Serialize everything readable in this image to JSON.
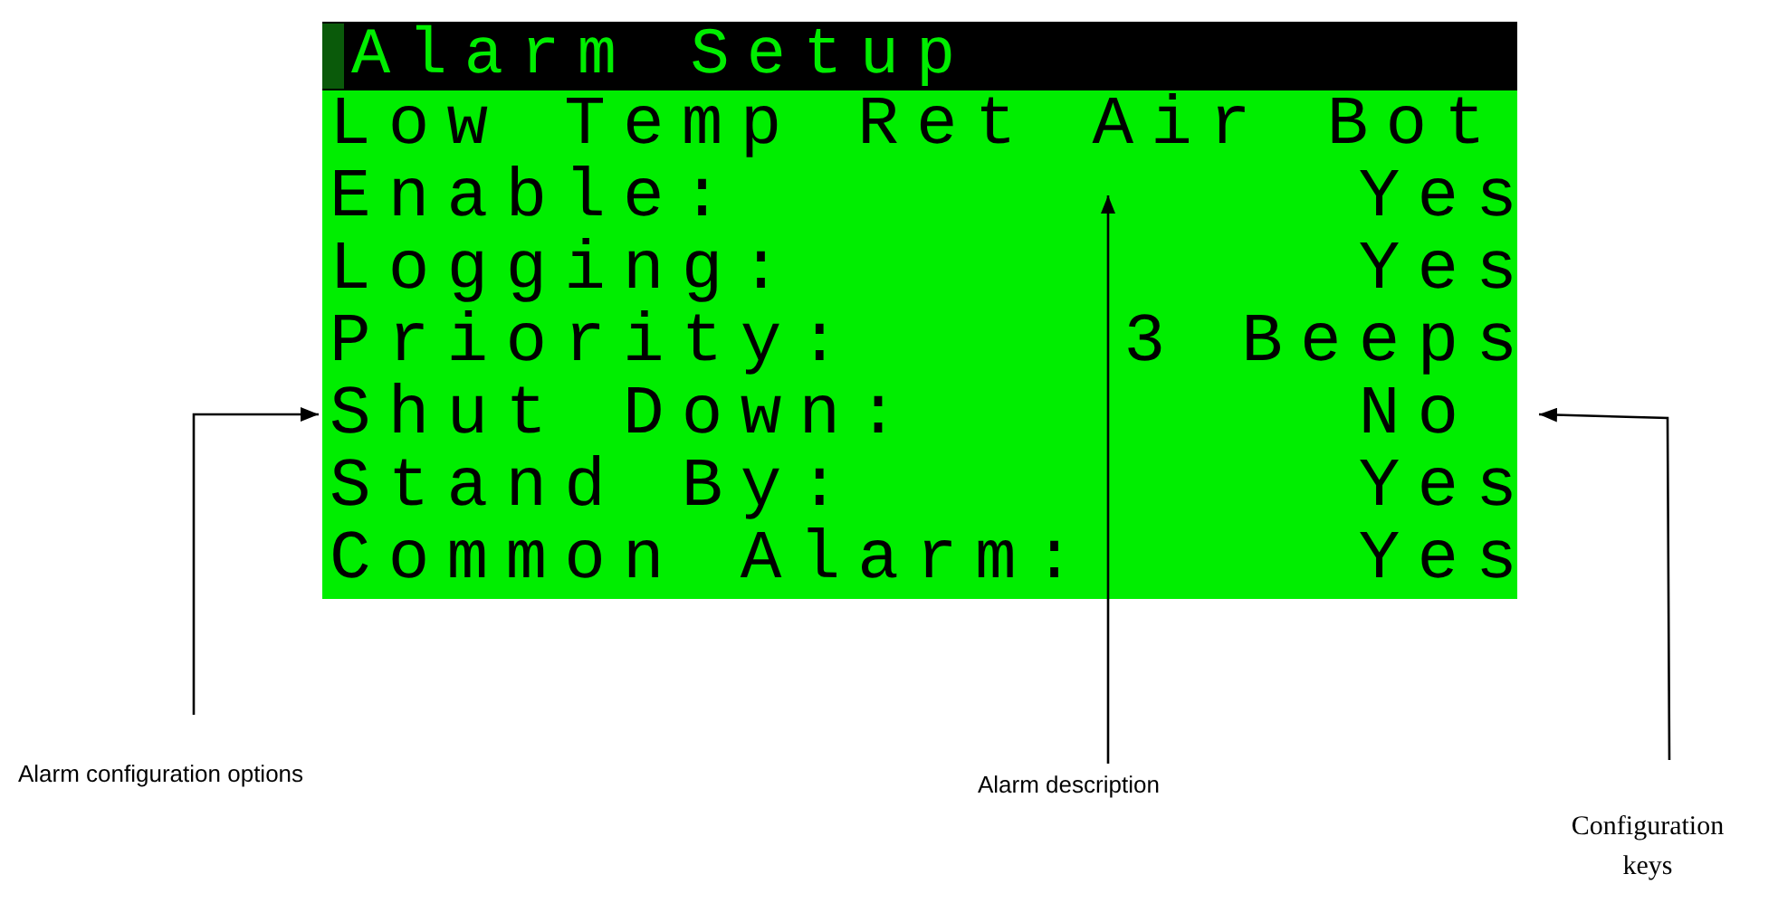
{
  "display": {
    "title": "Alarm Setup",
    "description": "Low Temp Ret Air Bot",
    "rows": [
      {
        "label": "Enable:",
        "value": "Yes"
      },
      {
        "label": "Logging:",
        "value": "Yes"
      },
      {
        "label": "Priority:",
        "value": "3 Beeps"
      },
      {
        "label": "Shut Down:",
        "value": "No "
      },
      {
        "label": "Stand By:",
        "value": "Yes"
      },
      {
        "label": "Common Alarm:",
        "value": "Yes"
      }
    ]
  },
  "callouts": [
    {
      "kind": "left",
      "text": "Alarm configuration options"
    },
    {
      "kind": "middle",
      "text": "Alarm description"
    },
    {
      "kind": "right",
      "text": "Configuration keys"
    }
  ]
}
